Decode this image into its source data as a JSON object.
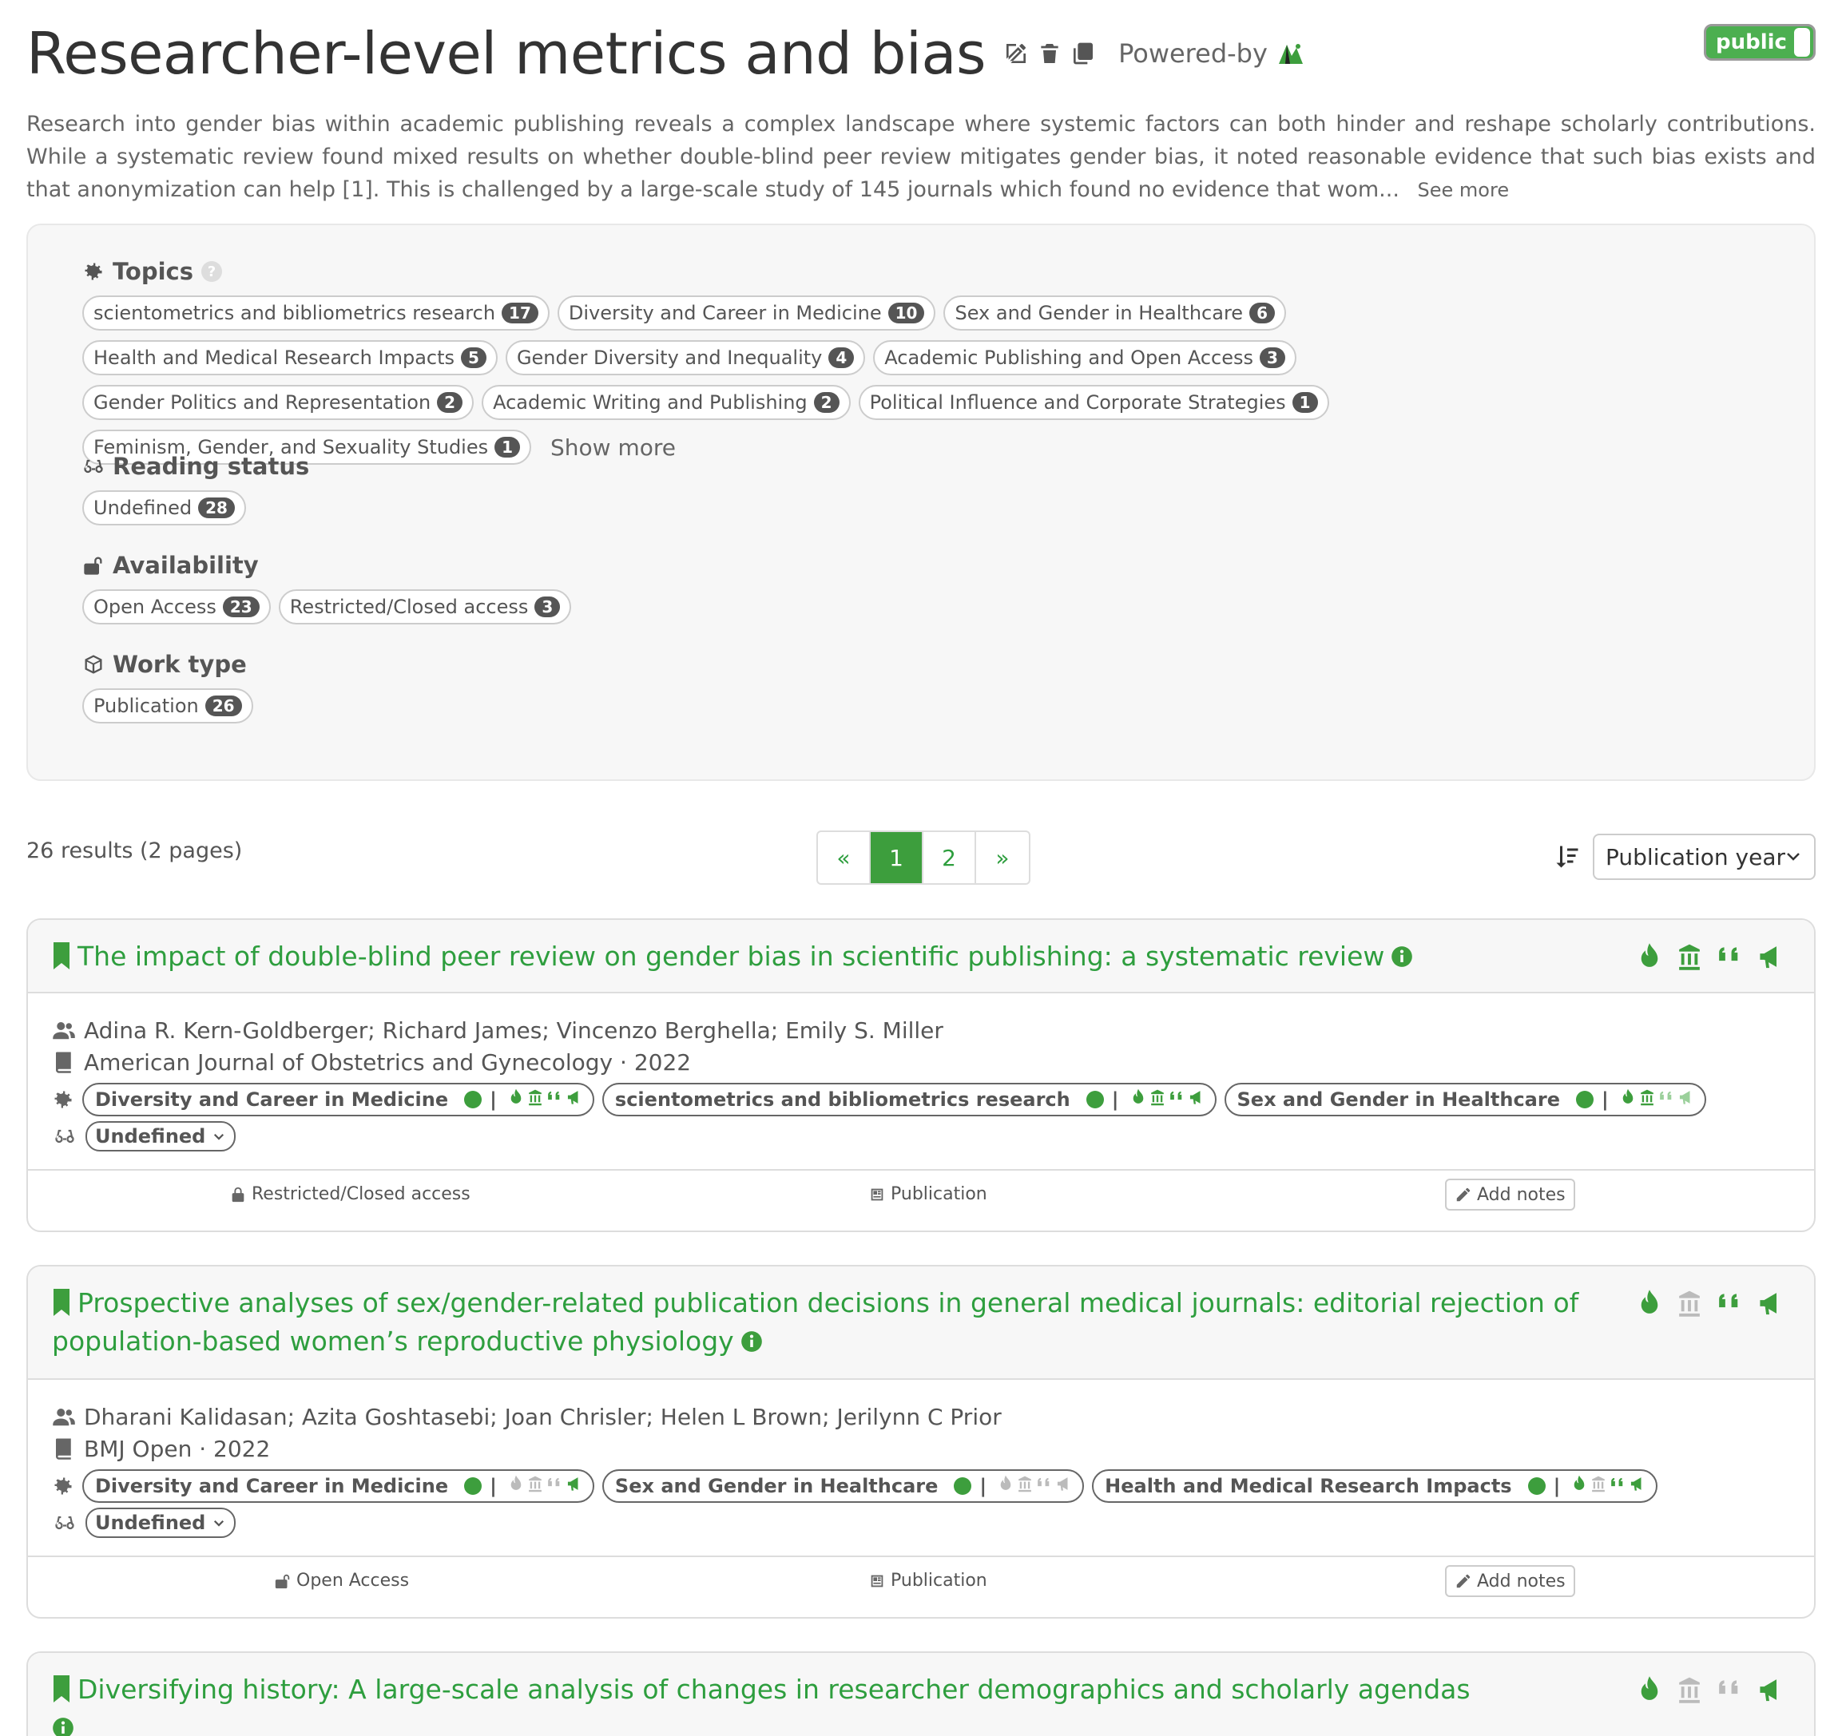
{
  "header": {
    "title": "Researcher-level metrics and bias",
    "powered_by": "Powered-by",
    "visibility": "public"
  },
  "summary": {
    "text": "Research into gender bias within academic publishing reveals a complex landscape where systemic factors can both hinder and reshape scholarly contributions. While a systematic review found mixed results on whether double-blind peer review mitigates gender bias, it noted reasonable evidence that such bias exists and that anonymization can help [1]. This is challenged by a large-scale study of 145 journals which found no evidence that wom...",
    "see_more": "See more"
  },
  "filters": {
    "topics": {
      "label": "Topics",
      "items": [
        {
          "label": "scientometrics and bibliometrics research",
          "count": "17"
        },
        {
          "label": "Diversity and Career in Medicine",
          "count": "10"
        },
        {
          "label": "Sex and Gender in Healthcare",
          "count": "6"
        },
        {
          "label": "Health and Medical Research Impacts",
          "count": "5"
        },
        {
          "label": "Gender Diversity and Inequality",
          "count": "4"
        },
        {
          "label": "Academic Publishing and Open Access",
          "count": "3"
        },
        {
          "label": "Gender Politics and Representation",
          "count": "2"
        },
        {
          "label": "Academic Writing and Publishing",
          "count": "2"
        },
        {
          "label": "Political Influence and Corporate Strategies",
          "count": "1"
        },
        {
          "label": "Feminism, Gender, and Sexuality Studies",
          "count": "1"
        }
      ],
      "show_more": "Show more"
    },
    "reading_status": {
      "label": "Reading status",
      "items": [
        {
          "label": "Undefined",
          "count": "28"
        }
      ]
    },
    "availability": {
      "label": "Availability",
      "items": [
        {
          "label": "Open Access",
          "count": "23"
        },
        {
          "label": "Restricted/Closed access",
          "count": "3"
        }
      ]
    },
    "work_type": {
      "label": "Work type",
      "items": [
        {
          "label": "Publication",
          "count": "26"
        }
      ]
    }
  },
  "results": {
    "count_text": "26 results (2 pages)",
    "pagination": {
      "prev": "«",
      "pages": [
        "1",
        "2"
      ],
      "current": "1",
      "next": "»"
    },
    "sort": {
      "selected": "Publication year"
    }
  },
  "papers": [
    {
      "title": "The impact of double-blind peer review on gender bias in scientific publishing: a systematic review",
      "authors": "Adina R. Kern-Goldberger; Richard James; Vincenzo Berghella; Emily S. Miller",
      "venue": "American Journal of Obstetrics and Gynecology · 2022",
      "topics": [
        "Diversity and Career in Medicine",
        "scientometrics and bibliometrics research",
        "Sex and Gender in Healthcare"
      ],
      "reading_status": "Undefined",
      "access": "Restricted/Closed access",
      "type": "Publication",
      "notes": "Add notes"
    },
    {
      "title": "Prospective analyses of sex/gender-related publication decisions in general medical journals: editorial rejection of population-based women’s reproductive physiology",
      "authors": "Dharani Kalidasan; Azita Goshtasebi; Joan Chrisler; Helen L Brown; Jerilynn C Prior",
      "venue": "BMJ Open · 2022",
      "topics": [
        "Diversity and Career in Medicine",
        "Sex and Gender in Healthcare",
        "Health and Medical Research Impacts"
      ],
      "reading_status": "Undefined",
      "access": "Open Access",
      "type": "Publication",
      "notes": "Add notes"
    },
    {
      "title": "Diversifying history: A large-scale analysis of changes in researcher demographics and scholarly agendas"
    }
  ],
  "colors": {
    "accent": "#3d9e3d",
    "text": "#555555",
    "panel": "#f7f7f7"
  }
}
